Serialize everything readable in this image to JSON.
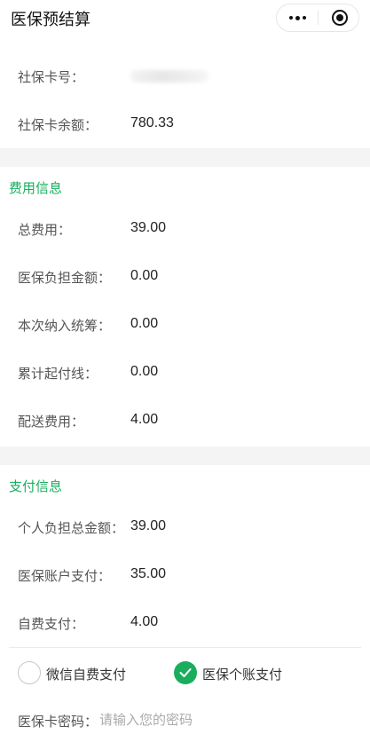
{
  "nav": {
    "title": "医保预结算"
  },
  "card": {
    "number_label": "社保卡号：",
    "balance_label": "社保卡余额：",
    "balance_value": "780.33"
  },
  "fee": {
    "title": "费用信息",
    "rows": [
      {
        "label": "总费用：",
        "value": "39.00"
      },
      {
        "label": "医保负担金额：",
        "value": "0.00"
      },
      {
        "label": "本次纳入统筹：",
        "value": "0.00"
      },
      {
        "label": "累计起付线：",
        "value": "0.00"
      },
      {
        "label": "配送费用：",
        "value": "4.00"
      }
    ]
  },
  "pay": {
    "title": "支付信息",
    "rows": [
      {
        "label": "个人负担总金额：",
        "value": "39.00"
      },
      {
        "label": "医保账户支付：",
        "value": "35.00"
      },
      {
        "label": "自费支付：",
        "value": "4.00"
      }
    ],
    "options": [
      {
        "label": "微信自费支付",
        "selected": false
      },
      {
        "label": "医保个账支付",
        "selected": true
      }
    ]
  },
  "password": {
    "label": "医保卡密码：",
    "placeholder": "请输入您的密码"
  },
  "colors": {
    "accent": "#1aad5e",
    "divider": "#ebebeb",
    "gap": "#f4f4f4"
  }
}
